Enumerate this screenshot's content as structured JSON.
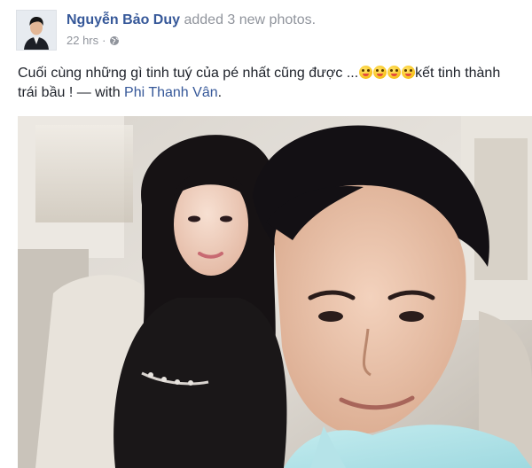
{
  "post": {
    "author": "Nguyễn Bảo Duy",
    "action": "added 3 new photos.",
    "time": "22 hrs",
    "separator": "·",
    "text_part1": "Cuối cùng những gì tinh tuý của pé nhất cũng được ...",
    "emoji_count": 4,
    "emoji_icon": "grinning-tongue-emoji",
    "text_part2": "kết tinh thành trái bầu ! — with ",
    "tagged": "Phi Thanh Vân",
    "tagged_suffix": ".",
    "privacy_icon": "globe-icon"
  },
  "colors": {
    "link": "#365899",
    "meta": "#90949c",
    "text": "#1d2129"
  }
}
